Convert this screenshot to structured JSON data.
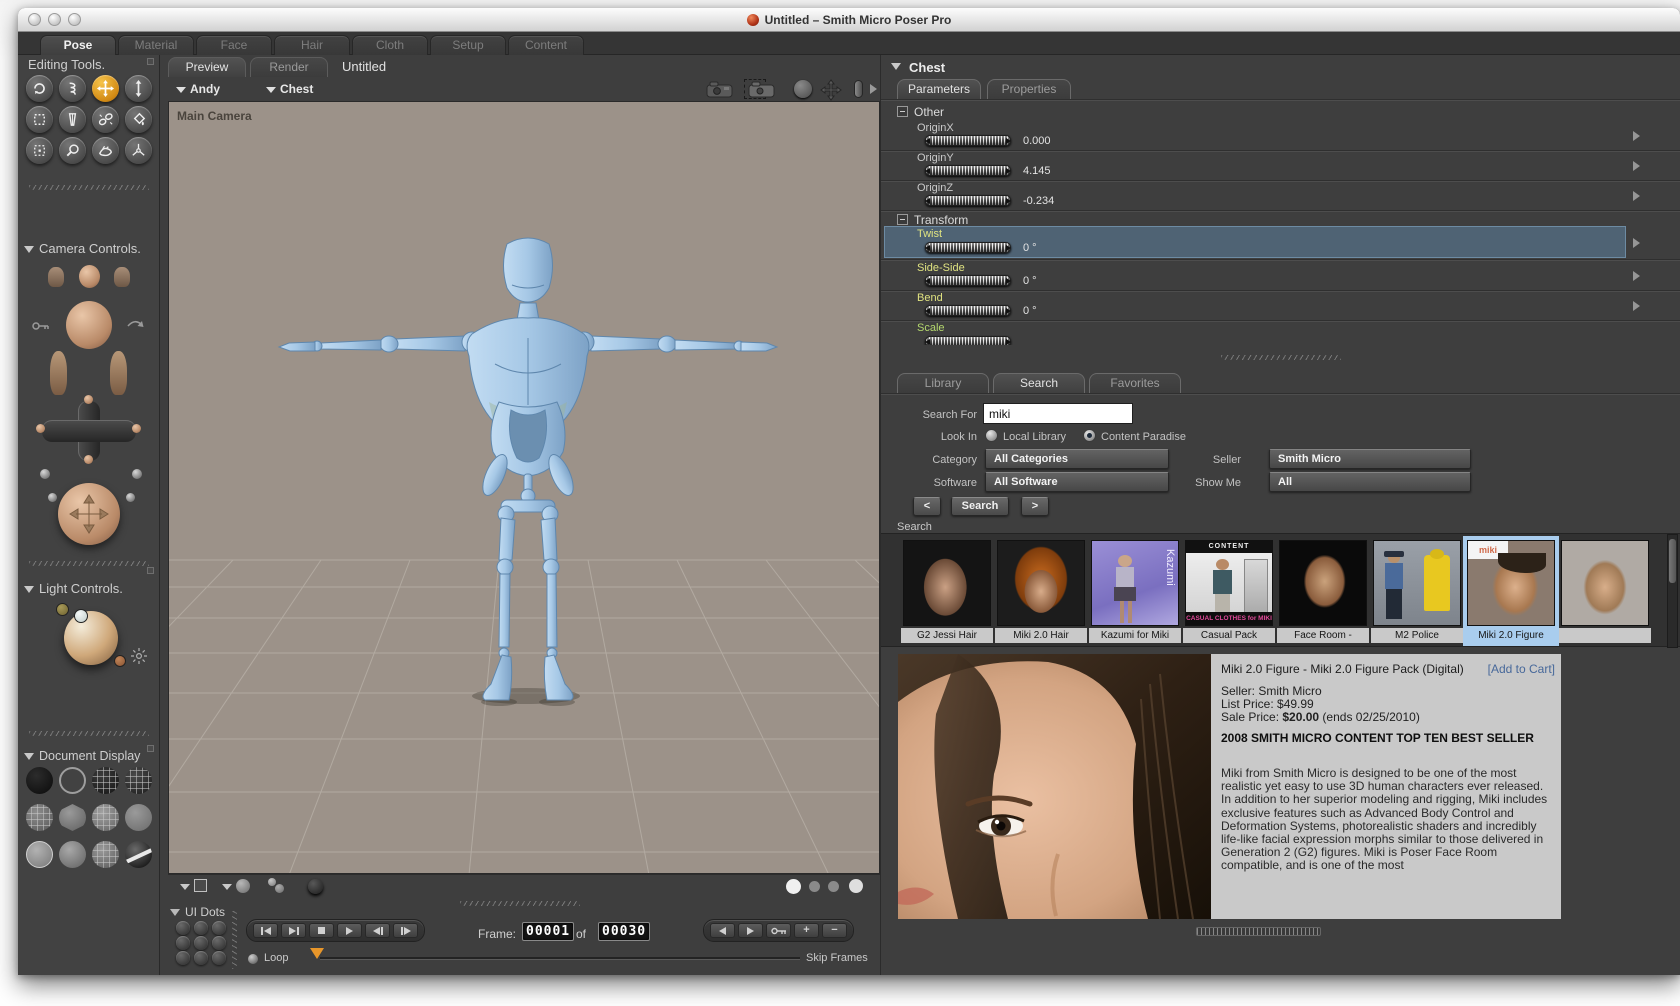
{
  "window": {
    "title": "Untitled – Smith Micro Poser Pro"
  },
  "main_tabs": {
    "items": [
      "Pose",
      "Material",
      "Face",
      "Hair",
      "Cloth",
      "Setup",
      "Content"
    ]
  },
  "left": {
    "editing_tools_title": "Editing Tools.",
    "camera_controls_title": "Camera Controls.",
    "light_controls_title": "Light Controls.",
    "document_display_title": "Document Display"
  },
  "document": {
    "tab_preview": "Preview",
    "tab_render": "Render",
    "doc_title": "Untitled",
    "actor": "Andy",
    "part": "Chest",
    "camera_label": "Main Camera",
    "ui_dots_label": "UI Dots",
    "frame_label": "Frame:",
    "frame_current": "00001",
    "frame_of": "of",
    "frame_total": "00030",
    "loop_label": "Loop",
    "skip_frames_label": "Skip Frames",
    "plus_icon": "+",
    "minus_icon": "−"
  },
  "params": {
    "header": "Chest",
    "tab_parameters": "Parameters",
    "tab_properties": "Properties",
    "group_other": "Other",
    "group_transform": "Transform",
    "rows": [
      {
        "label": "OriginX",
        "value": "0.000"
      },
      {
        "label": "OriginY",
        "value": "4.145"
      },
      {
        "label": "OriginZ",
        "value": "-0.234"
      },
      {
        "label": "Twist",
        "value": "0 °"
      },
      {
        "label": "Side-Side",
        "value": "0 °"
      },
      {
        "label": "Bend",
        "value": "0 °"
      },
      {
        "label": "Scale",
        "value": ""
      }
    ]
  },
  "library": {
    "tab_library": "Library",
    "tab_search": "Search",
    "tab_favorites": "Favorites",
    "search_for_label": "Search For",
    "search_value": "miki",
    "look_in_label": "Look In",
    "local_library_label": "Local Library",
    "content_paradise_label": "Content Paradise",
    "category_label": "Category",
    "category_value": "All Categories",
    "seller_label": "Seller",
    "seller_value": "Smith Micro",
    "software_label": "Software",
    "software_value": "All Software",
    "show_me_label": "Show Me",
    "show_me_value": "All",
    "prev_button": "<",
    "search_button": "Search",
    "next_button": ">",
    "section_label": "Search",
    "results": [
      {
        "label": "G2 Jessi Hair"
      },
      {
        "label": "Miki 2.0 Hair"
      },
      {
        "label": "Kazumi for Miki",
        "side_text": "Kazumi"
      },
      {
        "label": "Casual Pack",
        "top_text": "CONTENT",
        "strip_text": "CASUAL CLOTHES for MIKI"
      },
      {
        "label": "Face Room -"
      },
      {
        "label": "M2 Police"
      },
      {
        "label": "Miki 2.0 Figure",
        "logo_text": "miki"
      }
    ],
    "detail": {
      "title": "Miki 2.0 Figure - Miki 2.0 Figure Pack (Digital)",
      "add_to_cart": "[Add to Cart]",
      "seller": "Seller: Smith Micro",
      "list_price": "List Price: $49.99",
      "sale_prefix": "Sale Price:",
      "sale_amount": "$20.00",
      "sale_suffix": "(ends 02/25/2010)",
      "banner": "2008 SMITH MICRO CONTENT TOP TEN BEST SELLER",
      "description": "Miki from Smith Micro is designed to be one of the most realistic yet easy to use 3D human characters ever released. In addition to her superior modeling and rigging, Miki includes exclusive features such as Advanced Body Control and Deformation Systems, photorealistic shaders and incredibly life-like facial expression morphs similar to those delivered in Generation 2 (G2) figures. Miki is Poser Face Room compatible, and is one of the most"
    }
  }
}
